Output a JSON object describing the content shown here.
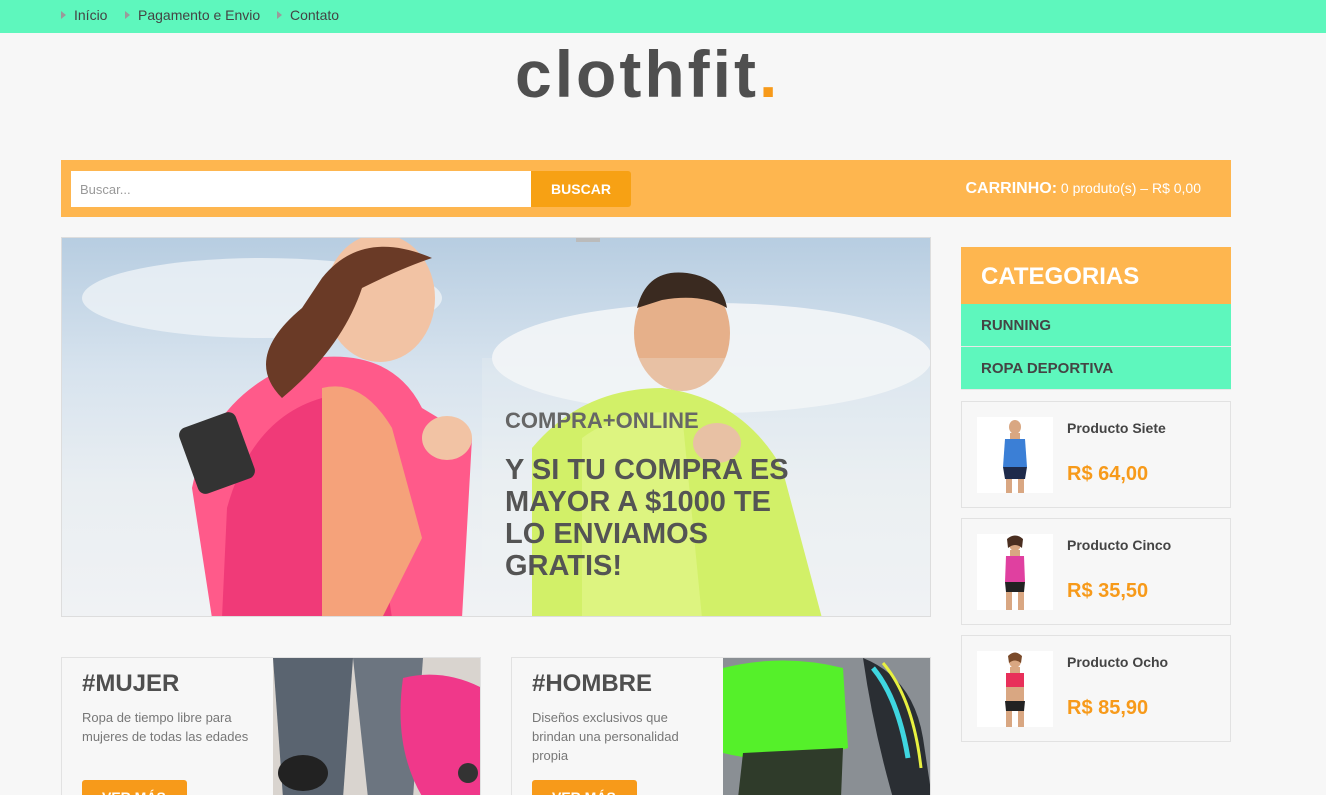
{
  "nav": {
    "items": [
      {
        "label": "Início"
      },
      {
        "label": "Pagamento e Envio"
      },
      {
        "label": "Contato"
      }
    ]
  },
  "brand": {
    "name": "clothfit",
    "dot": ".",
    "accent_color": "#f79a1a"
  },
  "search": {
    "placeholder": "Buscar...",
    "button_label": "BUSCAR"
  },
  "cart": {
    "label": "CARRINHO:",
    "summary": "0 produto(s) – R$ 0,00"
  },
  "hero": {
    "subtitle": "COMPRA+ONLINE",
    "title": "Y SI TU COMPRA ES MAYOR A $1000 TE LO ENVIAMOS GRATIS!"
  },
  "categories": {
    "heading": "CATEGORIAS",
    "items": [
      {
        "label": "RUNNING"
      },
      {
        "label": "ROPA DEPORTIVA"
      }
    ]
  },
  "products": [
    {
      "name": "Producto Siete",
      "price": "R$ 64,00",
      "top_color": "#3b7fd6"
    },
    {
      "name": "Producto Cinco",
      "price": "R$ 35,50",
      "top_color": "#e040a0"
    },
    {
      "name": "Producto Ocho",
      "price": "R$ 85,90",
      "top_color": "#e8305a"
    }
  ],
  "promos": [
    {
      "title": "#MUJER",
      "description": "Ropa de tiempo libre para mujeres de todas las edades",
      "button_label": "VER MÁS"
    },
    {
      "title": "#HOMBRE",
      "description": "Diseños exclusivos que brindan una personalidad propia",
      "button_label": "VER MÁS"
    }
  ],
  "colors": {
    "topbar": "#5ef7bd",
    "orange_bar": "#feb64f",
    "orange_button": "#f7a114",
    "text_dark": "#4f4f4f"
  }
}
